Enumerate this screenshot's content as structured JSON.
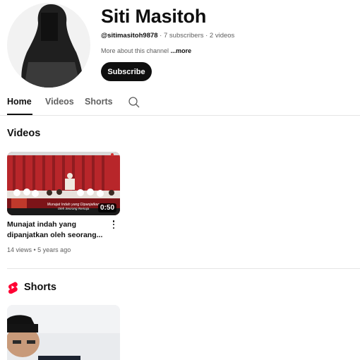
{
  "channel": {
    "name": "Siti Masitoh",
    "handle": "@sitimasitoh9878",
    "stats": " · 7 subscribers · 2 videos",
    "about": "More about this channel ",
    "about_more": "...more",
    "subscribe_label": "Subscribe"
  },
  "tabs": [
    {
      "label": "Home",
      "active": true
    },
    {
      "label": "Videos",
      "active": false
    },
    {
      "label": "Shorts",
      "active": false
    }
  ],
  "sections": {
    "videos_title": "Videos",
    "shorts_title": "Shorts"
  },
  "videos": [
    {
      "title": "Munajat indah yang dipanjatkan oleh seorang...",
      "duration": "0:50",
      "views": "14 views",
      "age": "5 years ago",
      "overlay_text": "Munajat Indah yang Dipanjatkan Oleh Seorang Remaja"
    }
  ],
  "colors": {
    "text": "#0f0f0f",
    "secondary": "#606060",
    "shorts_red": "#ff0033",
    "divider": "#e5e5e5"
  }
}
